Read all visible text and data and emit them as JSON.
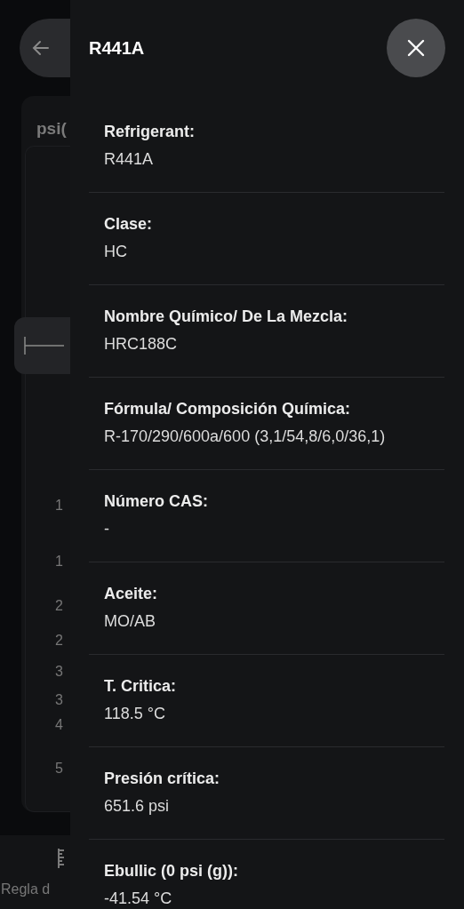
{
  "background": {
    "card_title": "psi(",
    "scale_labels": [
      "1",
      "1",
      "2",
      "2",
      "3",
      "3",
      "4",
      "5"
    ],
    "bottom_nav": [
      {
        "label": "Regla d"
      }
    ]
  },
  "panel": {
    "title": "R441A",
    "fields": [
      {
        "label": "Refrigerant:",
        "value": "R441A"
      },
      {
        "label": "Clase:",
        "value": "HC"
      },
      {
        "label": "Nombre Químico/ De La Mezcla:",
        "value": "HRC188C"
      },
      {
        "label": "Fórmula/ Composición Química:",
        "value": "R-170/290/600a/600 (3,1/54,8/6,0/36,1)"
      },
      {
        "label": "Número CAS:",
        "value": "-"
      },
      {
        "label": "Aceite:",
        "value": "MO/AB"
      },
      {
        "label": "T. Critica:",
        "value": "118.5 °C"
      },
      {
        "label": "Presión crítica:",
        "value": "651.6 psi"
      },
      {
        "label": "Ebullic (0 psi (g)):",
        "value": "-41.54 °C"
      }
    ]
  }
}
